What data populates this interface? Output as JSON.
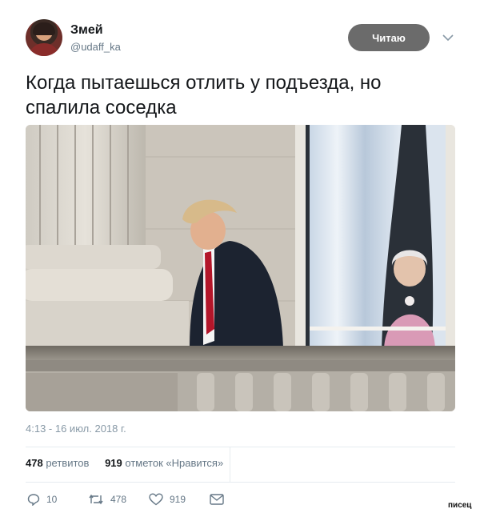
{
  "user": {
    "name": "Змей",
    "handle": "@udaff_ka"
  },
  "follow_button": "Читаю",
  "tweet": {
    "text": "Когда пытаешься отлить у подъезда, но спалила соседка",
    "timestamp": "4:13 - 16 июл. 2018 г."
  },
  "stats": {
    "retweets_count": "478",
    "retweets_label": "ретвитов",
    "likes_count": "919",
    "likes_label": "отметок «Нравится»"
  },
  "actions": {
    "reply_count": "10",
    "retweet_count": "478",
    "like_count": "919"
  },
  "watermark": "писец",
  "icons": [
    "chevron-down-icon",
    "reply-icon",
    "retweet-icon",
    "heart-icon",
    "mail-icon"
  ],
  "colors": {
    "follow_bg": "#6b6b6b",
    "secondary_text": "#657786"
  }
}
